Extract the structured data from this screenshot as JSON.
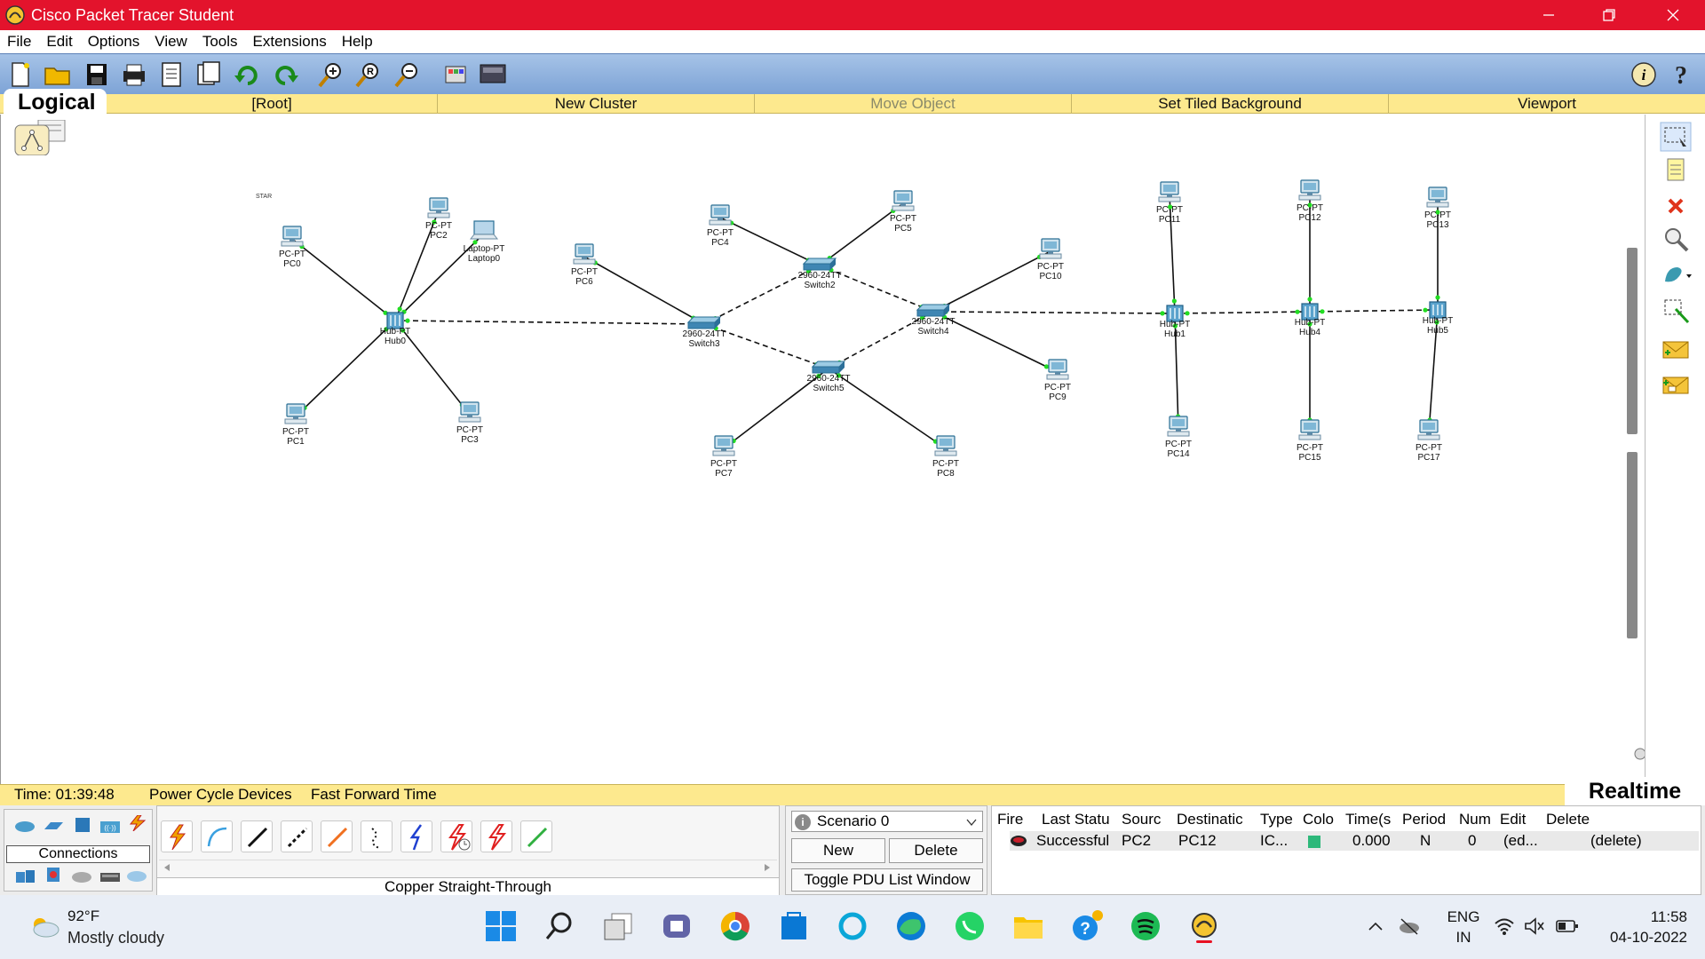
{
  "window": {
    "title": "Cisco Packet Tracer Student",
    "controls": [
      "minimize",
      "maximize",
      "close"
    ]
  },
  "menu": [
    "File",
    "Edit",
    "Options",
    "View",
    "Tools",
    "Extensions",
    "Help"
  ],
  "toolbar": {
    "icons": [
      "new-file-icon",
      "open-folder-icon",
      "save-icon",
      "print-icon",
      "activity-wizard-icon",
      "custom-device-icon",
      "copy-icon",
      "undo-icon",
      "redo-icon",
      "zoom-in-icon",
      "zoom-reset-icon",
      "zoom-out-icon",
      "palette-icon",
      "device-dialog-icon",
      "info-icon",
      "help-icon"
    ]
  },
  "logical_bar": {
    "tab": "Logical",
    "root": "[Root]",
    "new_cluster": "New Cluster",
    "move_object": "Move Object",
    "set_tiled_background": "Set Tiled Background",
    "viewport": "Viewport"
  },
  "topology": {
    "note": "STAR",
    "nodes": [
      {
        "id": "PC0",
        "type": "PC-PT",
        "kind": "pc"
      },
      {
        "id": "PC1",
        "type": "PC-PT",
        "kind": "pc"
      },
      {
        "id": "PC2",
        "type": "PC-PT",
        "kind": "pc"
      },
      {
        "id": "PC3",
        "type": "PC-PT",
        "kind": "pc"
      },
      {
        "id": "Laptop0",
        "type": "Laptop-PT",
        "kind": "laptop"
      },
      {
        "id": "Hub0",
        "type": "Hub-PT",
        "kind": "hub"
      },
      {
        "id": "PC6",
        "type": "PC-PT",
        "kind": "pc"
      },
      {
        "id": "Switch3",
        "type": "2960-24TT",
        "kind": "switch"
      },
      {
        "id": "PC4",
        "type": "PC-PT",
        "kind": "pc"
      },
      {
        "id": "PC5",
        "type": "PC-PT",
        "kind": "pc"
      },
      {
        "id": "Switch2",
        "type": "2960-24TT",
        "kind": "switch"
      },
      {
        "id": "Switch5",
        "type": "2960-24TT",
        "kind": "switch"
      },
      {
        "id": "PC7",
        "type": "PC-PT",
        "kind": "pc"
      },
      {
        "id": "PC8",
        "type": "PC-PT",
        "kind": "pc"
      },
      {
        "id": "Switch4",
        "type": "2960-24TT",
        "kind": "switch"
      },
      {
        "id": "PC10",
        "type": "PC-PT",
        "kind": "pc"
      },
      {
        "id": "PC9",
        "type": "PC-PT",
        "kind": "pc"
      },
      {
        "id": "PC11",
        "type": "PC-PT",
        "kind": "pc"
      },
      {
        "id": "Hub1",
        "type": "Hub-PT",
        "kind": "hub"
      },
      {
        "id": "PC14",
        "type": "PC-PT",
        "kind": "pc"
      },
      {
        "id": "PC12",
        "type": "PC-PT",
        "kind": "pc"
      },
      {
        "id": "Hub4",
        "type": "Hub-PT",
        "kind": "hub"
      },
      {
        "id": "PC15",
        "type": "PC-PT",
        "kind": "pc"
      },
      {
        "id": "PC13",
        "type": "PC-PT",
        "kind": "pc"
      },
      {
        "id": "Hub5",
        "type": "Hub-PT",
        "kind": "hub"
      },
      {
        "id": "PC17",
        "type": "PC-PT",
        "kind": "pc"
      }
    ],
    "links": [
      {
        "a": "PC0",
        "b": "Hub0",
        "style": "straight"
      },
      {
        "a": "PC1",
        "b": "Hub0",
        "style": "straight"
      },
      {
        "a": "PC2",
        "b": "Hub0",
        "style": "straight"
      },
      {
        "a": "PC3",
        "b": "Hub0",
        "style": "straight"
      },
      {
        "a": "Laptop0",
        "b": "Hub0",
        "style": "straight"
      },
      {
        "a": "Hub0",
        "b": "Switch3",
        "style": "crossover"
      },
      {
        "a": "PC6",
        "b": "Switch3",
        "style": "straight"
      },
      {
        "a": "Switch3",
        "b": "Switch2",
        "style": "crossover"
      },
      {
        "a": "Switch3",
        "b": "Switch5",
        "style": "crossover"
      },
      {
        "a": "PC4",
        "b": "Switch2",
        "style": "straight"
      },
      {
        "a": "PC5",
        "b": "Switch2",
        "style": "straight"
      },
      {
        "a": "Switch2",
        "b": "Switch4",
        "style": "crossover"
      },
      {
        "a": "Switch5",
        "b": "Switch4",
        "style": "crossover"
      },
      {
        "a": "PC7",
        "b": "Switch5",
        "style": "straight"
      },
      {
        "a": "PC8",
        "b": "Switch5",
        "style": "straight"
      },
      {
        "a": "PC10",
        "b": "Switch4",
        "style": "straight"
      },
      {
        "a": "PC9",
        "b": "Switch4",
        "style": "straight"
      },
      {
        "a": "Switch4",
        "b": "Hub1",
        "style": "crossover"
      },
      {
        "a": "PC11",
        "b": "Hub1",
        "style": "straight"
      },
      {
        "a": "PC14",
        "b": "Hub1",
        "style": "straight"
      },
      {
        "a": "Hub1",
        "b": "Hub4",
        "style": "crossover"
      },
      {
        "a": "PC12",
        "b": "Hub4",
        "style": "straight"
      },
      {
        "a": "PC15",
        "b": "Hub4",
        "style": "straight"
      },
      {
        "a": "Hub4",
        "b": "Hub5",
        "style": "crossover"
      },
      {
        "a": "PC13",
        "b": "Hub5",
        "style": "straight"
      },
      {
        "a": "PC17",
        "b": "Hub5",
        "style": "straight"
      }
    ]
  },
  "palette": {
    "icons": [
      "select-icon",
      "note-icon",
      "delete-icon",
      "inspect-icon",
      "draw-shape-icon",
      "resize-icon",
      "add-simple-pdu-icon",
      "add-complex-pdu-icon"
    ]
  },
  "status": {
    "time": "Time: 01:39:48",
    "power_cycle": "Power Cycle Devices",
    "fast_forward": "Fast Forward Time",
    "mode": "Realtime"
  },
  "devices": {
    "category_label": "Connections"
  },
  "cables": {
    "selected_name": "Copper Straight-Through",
    "items": [
      "automatic-connection-icon",
      "console-cable-icon",
      "straight-through-cable-icon",
      "crossover-cable-icon",
      "fiber-cable-icon",
      "phone-cable-icon",
      "coaxial-cable-icon",
      "serial-dce-cable-icon",
      "serial-dte-cable-icon",
      "octal-cable-icon"
    ],
    "colors": [
      "#f0a000",
      "#3aa0e0",
      "#111111",
      "#111111",
      "#f07020",
      "#111111",
      "#2040d0",
      "#e02020",
      "#e02020",
      "#30b040"
    ]
  },
  "scenario": {
    "selected": "Scenario 0",
    "new_label": "New",
    "delete_label": "Delete",
    "toggle_label": "Toggle PDU List Window"
  },
  "pdu_list": {
    "headers": [
      "Fire",
      "Last Statu",
      "Sourc",
      "Destinatic",
      "Type",
      "Colo",
      "Time(s",
      "Period",
      "Num",
      "Edit",
      "Delete"
    ],
    "rows": [
      {
        "status": "Successful",
        "source": "PC2",
        "destination": "PC12",
        "type": "IC...",
        "color": "#2db87a",
        "time": "0.000",
        "periodic": "N",
        "num": "0",
        "edit": "(ed...",
        "delete": "(delete)"
      }
    ]
  },
  "taskbar": {
    "weather_temp": "92°F",
    "weather_desc": "Mostly cloudy",
    "apps": [
      "start-icon",
      "search-icon",
      "task-view-icon",
      "teams-icon",
      "chrome-icon",
      "store-icon",
      "cortana-icon",
      "edge-icon",
      "whatsapp-icon",
      "file-explorer-icon",
      "help-app-icon",
      "spotify-icon",
      "packet-tracer-icon"
    ],
    "lang_top": "ENG",
    "lang_bottom": "IN",
    "time": "11:58",
    "date": "04-10-2022"
  }
}
